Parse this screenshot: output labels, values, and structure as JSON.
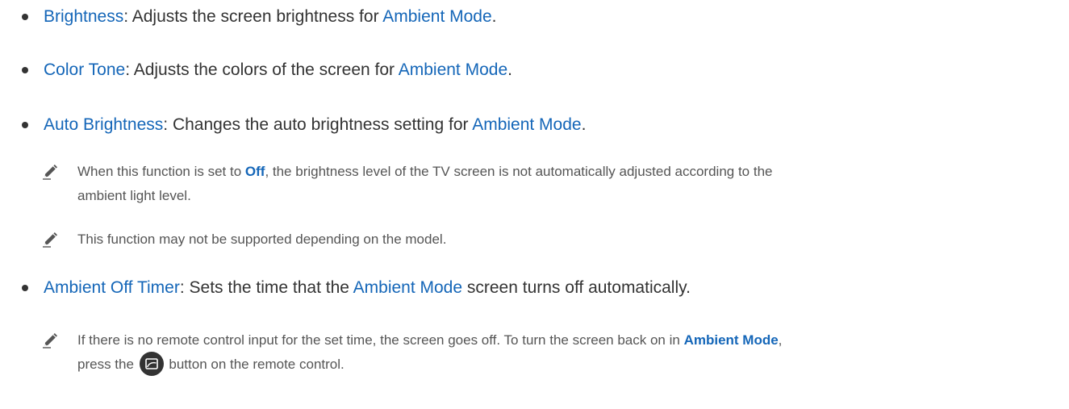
{
  "items": [
    {
      "term": "Brightness",
      "sep": ": ",
      "text": "Adjusts the screen brightness for ",
      "term2": "Ambient Mode",
      "end": "."
    },
    {
      "term": "Color Tone",
      "sep": ": ",
      "text": "Adjusts the colors of the screen for ",
      "term2": "Ambient Mode",
      "end": "."
    },
    {
      "term": "Auto Brightness",
      "sep": ": ",
      "text": "Changes the auto brightness setting for ",
      "term2": "Ambient Mode",
      "end": "."
    },
    {
      "term": "Ambient Off Timer",
      "sep": ": ",
      "text": "Sets the time that the ",
      "term2": "Ambient Mode",
      "end": " screen turns off automatically."
    }
  ],
  "notes": {
    "auto_brightness_1": {
      "pre": "When this function is set to ",
      "term": "Off",
      "post_line1": ", the brightness level of the TV screen is not automatically adjusted according to the",
      "line2": "ambient light level."
    },
    "auto_brightness_2": {
      "text": "This function may not be supported depending on the model."
    },
    "off_timer_1": {
      "line1": "If there is no remote control input for the set time, the screen goes off. To turn the screen back on in ",
      "term": "Ambient Mode",
      "line1_end": ",",
      "line2_pre": "press the ",
      "line2_post": " button on the remote control."
    }
  },
  "icons": {
    "note": "pencil-note-icon",
    "remote_button": "ambient-mode-button-icon"
  },
  "colors": {
    "term": "#1466b8",
    "body_text": "#333333",
    "note_text": "#555555"
  }
}
